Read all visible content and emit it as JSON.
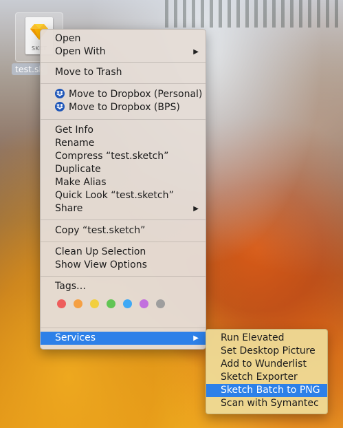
{
  "desktop": {
    "file_name": "test.sk",
    "file_ext_label": "SKET"
  },
  "context_menu": {
    "items": [
      {
        "label": "Open"
      },
      {
        "label": "Open With",
        "arrow": "▶"
      },
      {
        "label": "Move to Trash"
      },
      {
        "label": "Move to Dropbox (Personal)",
        "icon": "dropbox-icon"
      },
      {
        "label": "Move to Dropbox (BPS)",
        "icon": "dropbox-icon"
      },
      {
        "label": "Get Info"
      },
      {
        "label": "Rename"
      },
      {
        "label": "Compress “test.sketch”"
      },
      {
        "label": "Duplicate"
      },
      {
        "label": "Make Alias"
      },
      {
        "label": "Quick Look “test.sketch”"
      },
      {
        "label": "Share",
        "arrow": "▶"
      },
      {
        "label": "Copy “test.sketch”"
      },
      {
        "label": "Clean Up Selection"
      },
      {
        "label": "Show View Options"
      },
      {
        "label": "Tags…"
      },
      {
        "label": "Services",
        "arrow": "▶",
        "highlighted": true
      }
    ],
    "tag_colors": [
      {
        "name": "red",
        "color": "#ee5d5c"
      },
      {
        "name": "orange",
        "color": "#f5a043"
      },
      {
        "name": "yellow",
        "color": "#f2cf3f"
      },
      {
        "name": "green",
        "color": "#61c554"
      },
      {
        "name": "blue",
        "color": "#3fa9f5"
      },
      {
        "name": "purple",
        "color": "#c26fde"
      },
      {
        "name": "gray",
        "color": "#9e9e9e"
      }
    ]
  },
  "services_submenu": {
    "items": [
      {
        "label": "Run Elevated"
      },
      {
        "label": "Set Desktop Picture"
      },
      {
        "label": "Add to Wunderlist"
      },
      {
        "label": "Sketch Exporter"
      },
      {
        "label": "Sketch Batch to PNG",
        "highlighted": true
      },
      {
        "label": "Scan with Symantec"
      }
    ]
  },
  "colors": {
    "highlight": "#2d80e8",
    "menu_bg": "#e5ddd6",
    "submenu_bg": "#eeda96"
  }
}
